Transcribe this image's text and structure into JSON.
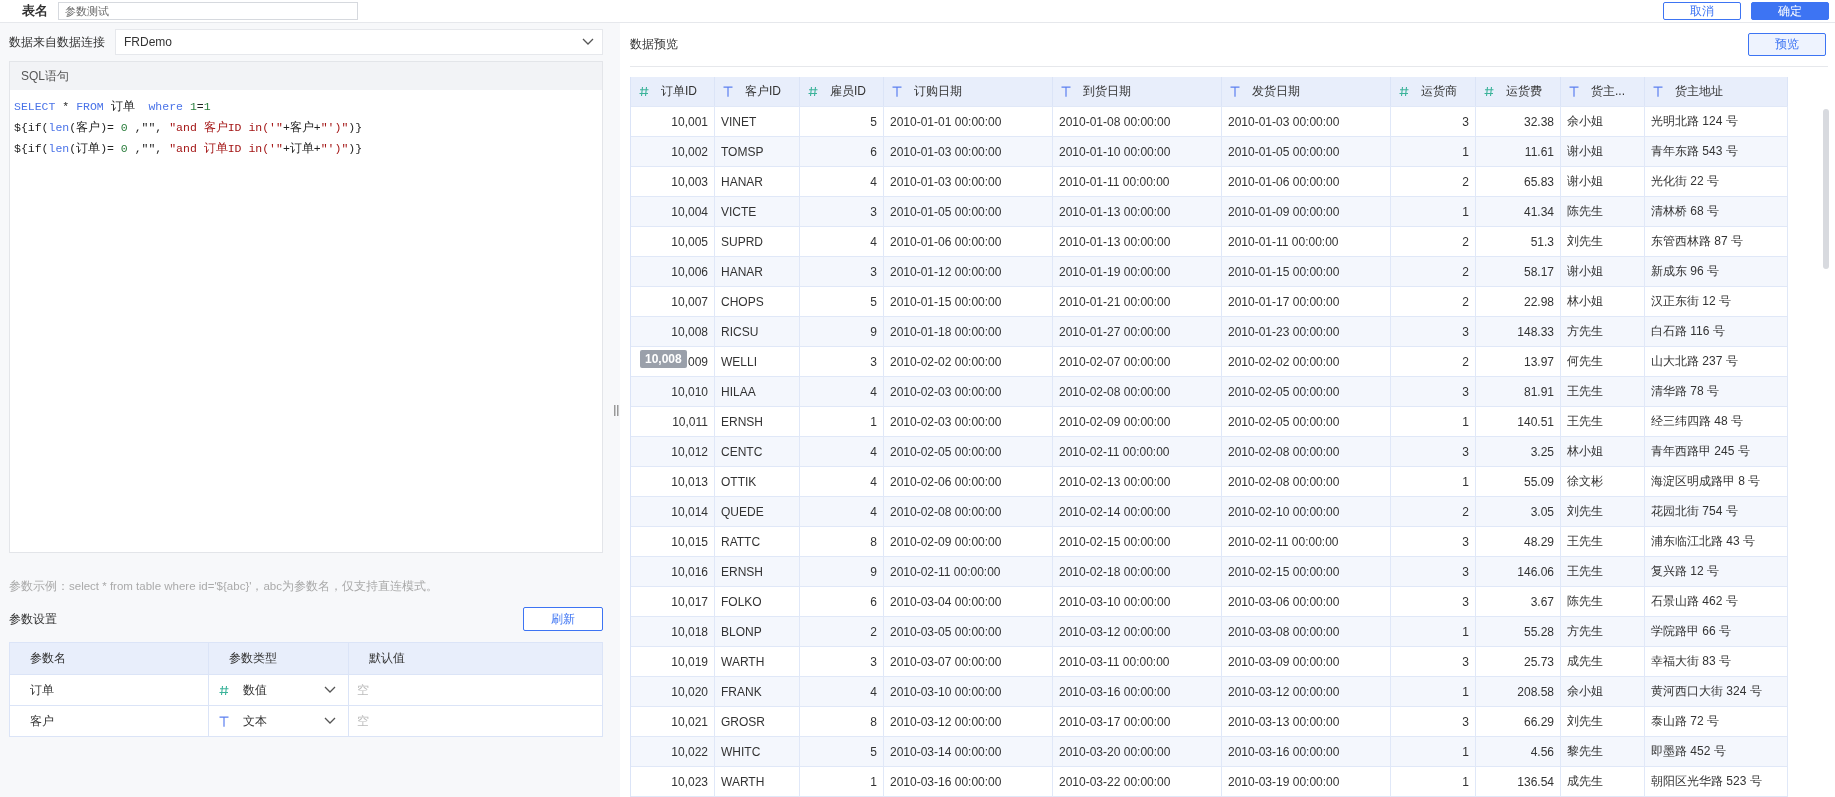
{
  "header": {
    "title": "表名",
    "name_value": "参数测试",
    "buttons": [
      {
        "label": "取消",
        "kind": "secondary"
      },
      {
        "label": "确定",
        "kind": "primary"
      }
    ]
  },
  "connection": {
    "label": "数据来自数据连接",
    "value": "FRDemo"
  },
  "sql": {
    "title": "SQL语句",
    "lines": [
      [
        {
          "text": "SELECT",
          "kind": "keyword"
        },
        {
          "text": " * ",
          "kind": "plain"
        },
        {
          "text": "FROM",
          "kind": "keyword"
        },
        {
          "text": " 订单  ",
          "kind": "plain"
        },
        {
          "text": "where ",
          "kind": "keyword"
        },
        {
          "text": "1",
          "kind": "number"
        },
        {
          "text": "=",
          "kind": "plain"
        },
        {
          "text": "1",
          "kind": "number"
        }
      ],
      [
        {
          "text": "${if(",
          "kind": "plain"
        },
        {
          "text": "len",
          "kind": "keyword"
        },
        {
          "text": "(客户)= ",
          "kind": "plain"
        },
        {
          "text": "0",
          "kind": "number"
        },
        {
          "text": " ,\"\", ",
          "kind": "plain"
        },
        {
          "text": "\"and 客户ID in('\"",
          "kind": "string"
        },
        {
          "text": "+客户+",
          "kind": "plain"
        },
        {
          "text": "\"')\"",
          "kind": "string"
        },
        {
          "text": ")}",
          "kind": "plain"
        }
      ],
      [
        {
          "text": "${if(",
          "kind": "plain"
        },
        {
          "text": "len",
          "kind": "keyword"
        },
        {
          "text": "(订单)= ",
          "kind": "plain"
        },
        {
          "text": "0",
          "kind": "number"
        },
        {
          "text": " ,\"\", ",
          "kind": "plain"
        },
        {
          "text": "\"and 订单ID in('\"",
          "kind": "string"
        },
        {
          "text": "+订单+",
          "kind": "plain"
        },
        {
          "text": "\"')\"",
          "kind": "string"
        },
        {
          "text": ")}",
          "kind": "plain"
        }
      ]
    ]
  },
  "hint": "参数示例：select * from table where id='${abc}'，abc为参数名，仅支持直连模式。",
  "params": {
    "title": "参数设置",
    "refresh_button": "刷新",
    "columns": [
      "参数名",
      "参数类型",
      "默认值"
    ],
    "rows": [
      {
        "name": "订单",
        "kind": "number",
        "type_label": "数值",
        "placeholder": "空"
      },
      {
        "name": "客户",
        "kind": "text",
        "type_label": "文本",
        "placeholder": "空"
      }
    ]
  },
  "preview": {
    "title": "数据预览",
    "button": "预览",
    "tooltip": "10,008",
    "columns": [
      {
        "label": "订单ID",
        "kind": "number"
      },
      {
        "label": "客户ID",
        "kind": "text"
      },
      {
        "label": "雇员ID",
        "kind": "number"
      },
      {
        "label": "订购日期",
        "kind": "text"
      },
      {
        "label": "到货日期",
        "kind": "text"
      },
      {
        "label": "发货日期",
        "kind": "text"
      },
      {
        "label": "运货商",
        "kind": "number"
      },
      {
        "label": "运货费",
        "kind": "number"
      },
      {
        "label": "货主...",
        "kind": "text"
      },
      {
        "label": "货主地址",
        "kind": "text"
      }
    ],
    "rows": [
      [
        "10,001",
        "VINET",
        "5",
        "2010-01-01 00:00:00",
        "2010-01-08 00:00:00",
        "2010-01-03 00:00:00",
        "3",
        "32.38",
        "余小姐",
        "光明北路 124 号"
      ],
      [
        "10,002",
        "TOMSP",
        "6",
        "2010-01-03 00:00:00",
        "2010-01-10 00:00:00",
        "2010-01-05 00:00:00",
        "1",
        "11.61",
        "谢小姐",
        "青年东路 543 号"
      ],
      [
        "10,003",
        "HANAR",
        "4",
        "2010-01-03 00:00:00",
        "2010-01-11 00:00:00",
        "2010-01-06 00:00:00",
        "2",
        "65.83",
        "谢小姐",
        "光化街 22 号"
      ],
      [
        "10,004",
        "VICTE",
        "3",
        "2010-01-05 00:00:00",
        "2010-01-13 00:00:00",
        "2010-01-09 00:00:00",
        "1",
        "41.34",
        "陈先生",
        "清林桥 68 号"
      ],
      [
        "10,005",
        "SUPRD",
        "4",
        "2010-01-06 00:00:00",
        "2010-01-13 00:00:00",
        "2010-01-11 00:00:00",
        "2",
        "51.3",
        "刘先生",
        "东管西林路 87 号"
      ],
      [
        "10,006",
        "HANAR",
        "3",
        "2010-01-12 00:00:00",
        "2010-01-19 00:00:00",
        "2010-01-15 00:00:00",
        "2",
        "58.17",
        "谢小姐",
        "新成东 96 号"
      ],
      [
        "10,007",
        "CHOPS",
        "5",
        "2010-01-15 00:00:00",
        "2010-01-21 00:00:00",
        "2010-01-17 00:00:00",
        "2",
        "22.98",
        "林小姐",
        "汉正东街 12 号"
      ],
      [
        "10,008",
        "RICSU",
        "9",
        "2010-01-18 00:00:00",
        "2010-01-27 00:00:00",
        "2010-01-23 00:00:00",
        "3",
        "148.33",
        "方先生",
        "白石路 116 号"
      ],
      [
        "009",
        "WELLI",
        "3",
        "2010-02-02 00:00:00",
        "2010-02-07 00:00:00",
        "2010-02-02 00:00:00",
        "2",
        "13.97",
        "何先生",
        "山大北路 237 号"
      ],
      [
        "10,010",
        "HILAA",
        "4",
        "2010-02-03 00:00:00",
        "2010-02-08 00:00:00",
        "2010-02-05 00:00:00",
        "3",
        "81.91",
        "王先生",
        "清华路 78 号"
      ],
      [
        "10,011",
        "ERNSH",
        "1",
        "2010-02-03 00:00:00",
        "2010-02-09 00:00:00",
        "2010-02-05 00:00:00",
        "1",
        "140.51",
        "王先生",
        "经三纬四路 48 号"
      ],
      [
        "10,012",
        "CENTC",
        "4",
        "2010-02-05 00:00:00",
        "2010-02-11 00:00:00",
        "2010-02-08 00:00:00",
        "3",
        "3.25",
        "林小姐",
        "青年西路甲 245 号"
      ],
      [
        "10,013",
        "OTTIK",
        "4",
        "2010-02-06 00:00:00",
        "2010-02-13 00:00:00",
        "2010-02-08 00:00:00",
        "1",
        "55.09",
        "徐文彬",
        "海淀区明成路甲 8 号"
      ],
      [
        "10,014",
        "QUEDE",
        "4",
        "2010-02-08 00:00:00",
        "2010-02-14 00:00:00",
        "2010-02-10 00:00:00",
        "2",
        "3.05",
        "刘先生",
        "花园北街 754 号"
      ],
      [
        "10,015",
        "RATTC",
        "8",
        "2010-02-09 00:00:00",
        "2010-02-15 00:00:00",
        "2010-02-11 00:00:00",
        "3",
        "48.29",
        "王先生",
        "浦东临江北路 43 号"
      ],
      [
        "10,016",
        "ERNSH",
        "9",
        "2010-02-11 00:00:00",
        "2010-02-18 00:00:00",
        "2010-02-15 00:00:00",
        "3",
        "146.06",
        "王先生",
        "复兴路 12 号"
      ],
      [
        "10,017",
        "FOLKO",
        "6",
        "2010-03-04 00:00:00",
        "2010-03-10 00:00:00",
        "2010-03-06 00:00:00",
        "3",
        "3.67",
        "陈先生",
        "石景山路 462 号"
      ],
      [
        "10,018",
        "BLONP",
        "2",
        "2010-03-05 00:00:00",
        "2010-03-12 00:00:00",
        "2010-03-08 00:00:00",
        "1",
        "55.28",
        "方先生",
        "学院路甲 66 号"
      ],
      [
        "10,019",
        "WARTH",
        "3",
        "2010-03-07 00:00:00",
        "2010-03-11 00:00:00",
        "2010-03-09 00:00:00",
        "3",
        "25.73",
        "成先生",
        "幸福大街 83 号"
      ],
      [
        "10,020",
        "FRANK",
        "4",
        "2010-03-10 00:00:00",
        "2010-03-16 00:00:00",
        "2010-03-12 00:00:00",
        "1",
        "208.58",
        "余小姐",
        "黄河西口大街 324 号"
      ],
      [
        "10,021",
        "GROSR",
        "8",
        "2010-03-12 00:00:00",
        "2010-03-17 00:00:00",
        "2010-03-13 00:00:00",
        "3",
        "66.29",
        "刘先生",
        "泰山路 72 号"
      ],
      [
        "10,022",
        "WHITC",
        "5",
        "2010-03-14 00:00:00",
        "2010-03-20 00:00:00",
        "2010-03-16 00:00:00",
        "1",
        "4.56",
        "黎先生",
        "即墨路 452 号"
      ],
      [
        "10,023",
        "WARTH",
        "1",
        "2010-03-16 00:00:00",
        "2010-03-22 00:00:00",
        "2010-03-19 00:00:00",
        "1",
        "136.54",
        "成先生",
        "朝阳区光华路 523 号"
      ]
    ]
  }
}
